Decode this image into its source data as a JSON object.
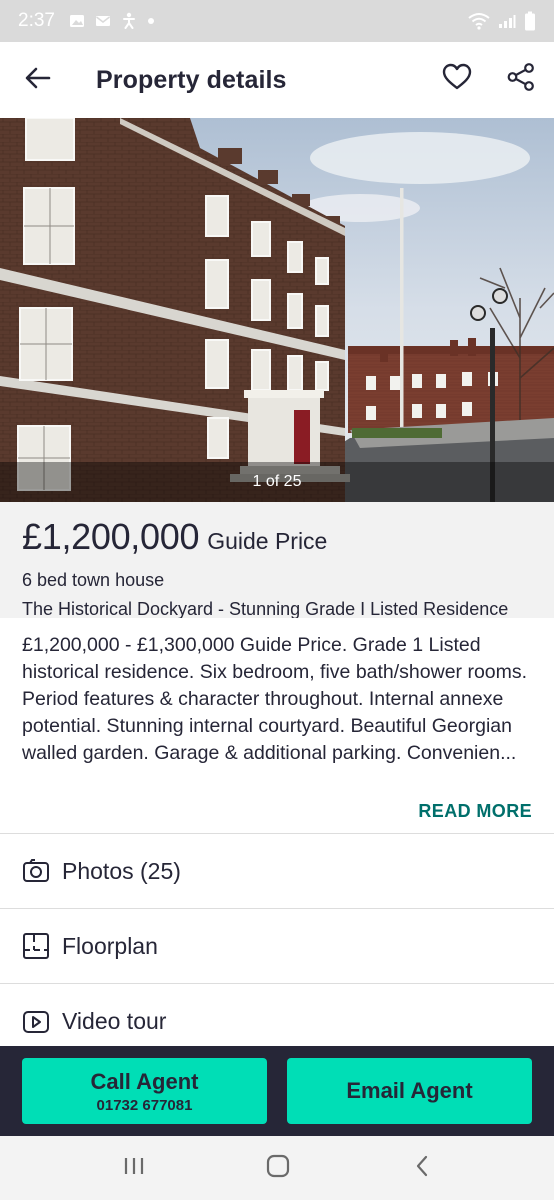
{
  "status_bar": {
    "time": "2:37",
    "left_icons": [
      "image-icon",
      "mail-icon",
      "accessibility-icon",
      "dot-icon"
    ],
    "right_icons": [
      "wifi-icon",
      "signal-icon",
      "battery-icon"
    ]
  },
  "app_bar": {
    "title": "Property details",
    "back_icon": "arrow-left-icon",
    "favourite_icon": "heart-icon",
    "share_icon": "share-icon"
  },
  "gallery": {
    "counter": "1 of 25"
  },
  "listing": {
    "price": "£1,200,000",
    "price_qualifier": "Guide Price",
    "property_type": "6 bed town house",
    "address": "The Historical Dockyard - Stunning Grade I Listed Residence"
  },
  "description": {
    "text": "£1,200,000 - £1,300,000 Guide Price. Grade 1 Listed historical residence. Six bedroom, five bath/shower rooms. Period features & character throughout. Internal annexe potential. Stunning internal courtyard. Beautiful Georgian walled garden. Garage & additional parking. Convenien...",
    "read_more": "READ MORE"
  },
  "media_rows": [
    {
      "label": "Photos (25)",
      "icon": "camera-icon"
    },
    {
      "label": "Floorplan",
      "icon": "floorplan-icon"
    },
    {
      "label": "Video tour",
      "icon": "play-icon"
    }
  ],
  "actions": {
    "call_label": "Call Agent",
    "call_number": "01732 677081",
    "email_label": "Email Agent"
  },
  "system_nav": {
    "icons": [
      "recent-apps-icon",
      "home-icon",
      "back-icon"
    ]
  },
  "colors": {
    "accent": "#00deb6",
    "link": "#006f6b",
    "dark": "#262637",
    "panel": "#f2f2f2"
  }
}
